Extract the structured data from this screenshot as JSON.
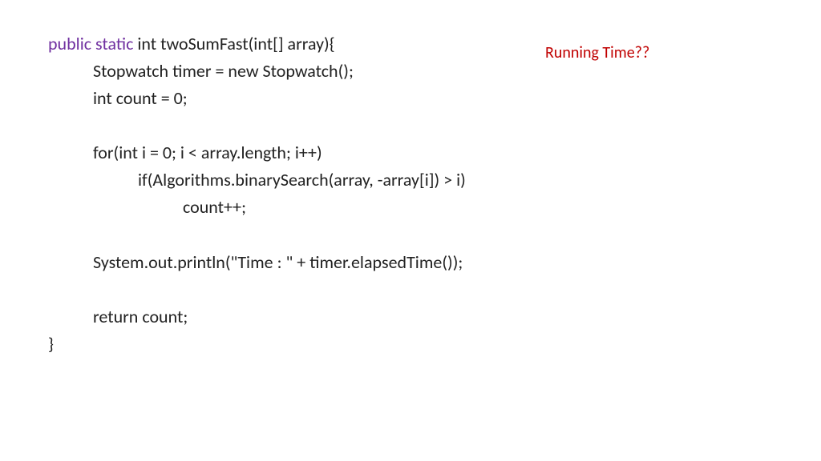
{
  "code": {
    "line1_keyword": "public static ",
    "line1_rest": "int twoSumFast(int[] array){",
    "line2": "Stopwatch timer = new Stopwatch();",
    "line3": "int count = 0;",
    "line4": "for(int i = 0; i < array.length; i++)",
    "line5": "if(Algorithms.binarySearch(array, -array[i]) > i)",
    "line6": "count++;",
    "line7": "System.out.println(\"Time : \" + timer.elapsedTime());",
    "line8": "return count;",
    "line9": "}"
  },
  "annotation": "Running Time??"
}
